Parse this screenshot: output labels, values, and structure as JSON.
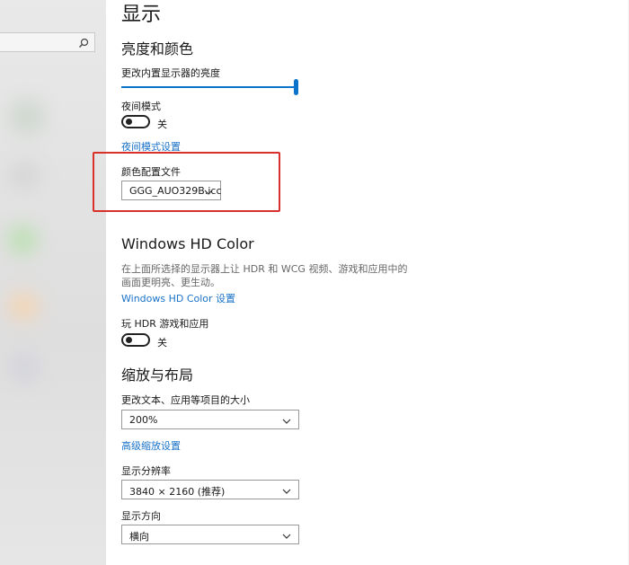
{
  "colors": {
    "accent": "#0b73c9",
    "link": "#1a73c8",
    "highlight": "#d9302c"
  },
  "nav": {
    "search_icon": "search-icon"
  },
  "page": {
    "title": "显示"
  },
  "brightness": {
    "section_title": "亮度和颜色",
    "slider_label": "更改内置显示器的亮度",
    "slider_value_percent": 100,
    "night_mode_label": "夜间模式",
    "night_mode_state": "关",
    "night_mode_settings_link": "夜间模式设置",
    "color_profile_label": "颜色配置文件",
    "color_profile_value": "GGG_AUO329B.icc"
  },
  "hd_color": {
    "section_title": "Windows HD Color",
    "description": "在上面所选择的显示器上让 HDR 和 WCG 视频、游戏和应用中的画面更明亮、更生动。",
    "settings_link": "Windows HD Color 设置",
    "hdr_label": "玩 HDR 游戏和应用",
    "hdr_state": "关"
  },
  "scale": {
    "section_title": "缩放与布局",
    "size_label": "更改文本、应用等项目的大小",
    "size_value": "200%",
    "advanced_link": "高级缩放设置",
    "resolution_label": "显示分辨率",
    "resolution_value": "3840 × 2160 (推荐)",
    "orientation_label": "显示方向",
    "orientation_value": "横向"
  }
}
